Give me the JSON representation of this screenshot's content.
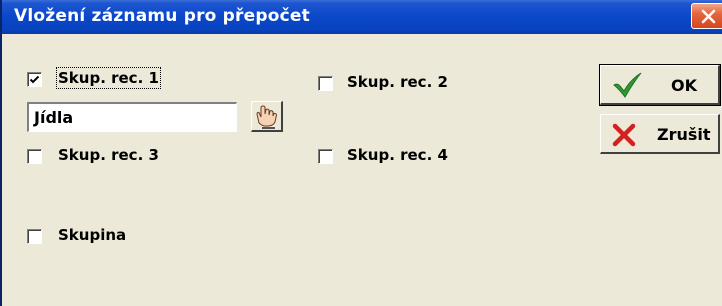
{
  "dialog": {
    "title": "Vložení záznamu pro přepočet",
    "close_icon": "close-icon"
  },
  "checkboxes": [
    {
      "label": "Skup. rec. 1",
      "checked": true
    },
    {
      "label": "Skup. rec. 2",
      "checked": false
    },
    {
      "label": "Skup. rec. 3",
      "checked": false
    },
    {
      "label": "Skup. rec. 4",
      "checked": false
    },
    {
      "label": "Skupina",
      "checked": false
    }
  ],
  "group_input": {
    "value": "Jídla"
  },
  "pick_button": {
    "icon": "hand-pointer-icon"
  },
  "buttons": {
    "ok": {
      "label": "OK",
      "icon": "checkmark-icon",
      "icon_color": "#2f9a2f"
    },
    "cancel": {
      "label": "Zrušit",
      "icon": "x-icon",
      "icon_color": "#d42020"
    }
  },
  "colors": {
    "titlebar": "#0a47c8",
    "dialog_bg": "#ece9d8",
    "close_button": "#d4461e"
  }
}
